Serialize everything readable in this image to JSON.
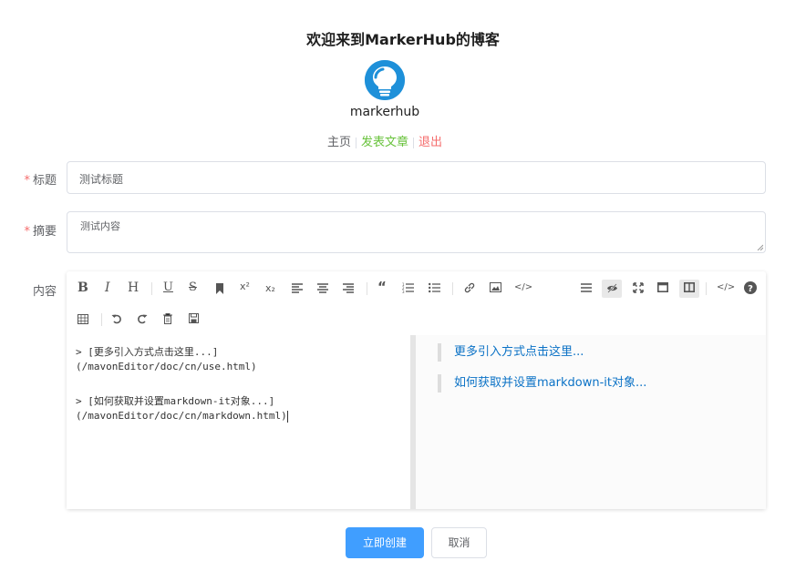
{
  "site": {
    "title": "欢迎来到MarkerHub的博客",
    "name": "markerhub",
    "brand_color": "#1e90d9"
  },
  "nav": {
    "home": "主页",
    "post": "发表文章",
    "logout": "退出"
  },
  "form": {
    "title_label": "标题",
    "title_value": "测试标题",
    "summary_label": "摘要",
    "summary_value": "测试内容",
    "content_label": "内容",
    "required_mark": "*"
  },
  "editor": {
    "toolbar_row1_left": [
      "bold",
      "italic",
      "header",
      "underline",
      "strikethrough",
      "mark",
      "superscript",
      "subscript",
      "align-left",
      "align-center",
      "align-right",
      "quote",
      "ordered-list",
      "unordered-list",
      "link",
      "image",
      "code"
    ],
    "toolbar_row1_right": [
      "navigation",
      "preview-toggle",
      "fullscreen",
      "read-mode",
      "subfield",
      "html-code",
      "help"
    ],
    "toolbar_row2": [
      "table",
      "undo",
      "redo",
      "trash",
      "save"
    ],
    "source_lines": [
      "> [更多引入方式点击这里...]",
      "(/mavonEditor/doc/cn/use.html)",
      "",
      "> [如何获取并设置markdown-it对象...]",
      "(/mavonEditor/doc/cn/markdown.html)"
    ],
    "preview_quotes": [
      "更多引入方式点击这里...",
      "如何获取并设置markdown-it对象..."
    ]
  },
  "buttons": {
    "create": "立即创建",
    "cancel": "取消"
  }
}
